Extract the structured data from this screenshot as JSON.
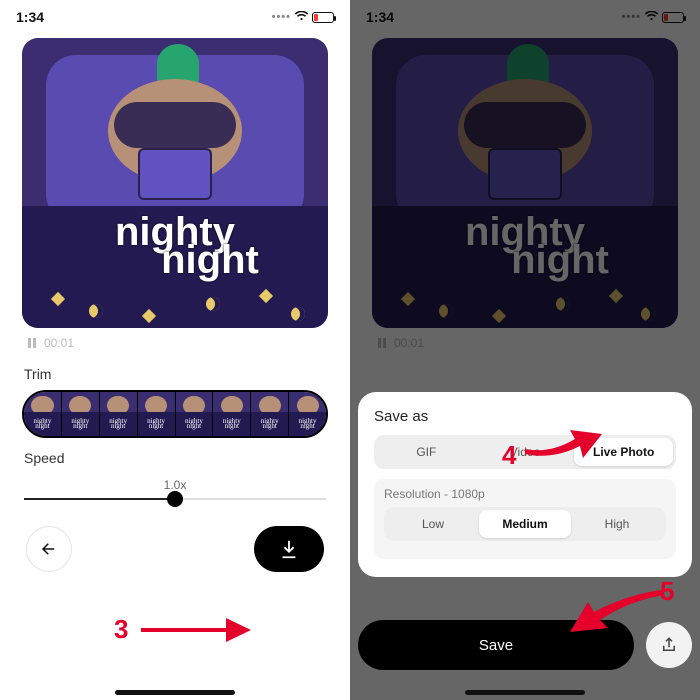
{
  "statusbar": {
    "time": "1:34"
  },
  "player": {
    "timecode": "00:01"
  },
  "image_text": {
    "line1": "nighty",
    "line2": "night"
  },
  "trim": {
    "label": "Trim",
    "frames": 8
  },
  "speed": {
    "label": "Speed",
    "value": "1.0x"
  },
  "saveSheet": {
    "title": "Save as",
    "formats": [
      "GIF",
      "Video",
      "Live Photo"
    ],
    "selectedFormat": 2,
    "resolutionLabel": "Resolution - 1080p",
    "qualities": [
      "Low",
      "Medium",
      "High"
    ],
    "selectedQuality": 1,
    "saveLabel": "Save"
  },
  "steps": {
    "s3": "3",
    "s4": "4",
    "s5": "5"
  }
}
